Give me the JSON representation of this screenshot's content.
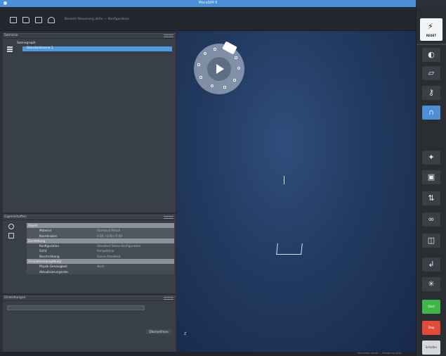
{
  "window": {
    "title": "MecaSIM 6"
  },
  "toolbar": {
    "icons": [
      "new-file-icon",
      "open-folder-icon",
      "save-icon",
      "network-icon"
    ],
    "path_text": "Bereich Steuerung aktiv — Konfiguration"
  },
  "scene": {
    "header": "Szenario",
    "root_label": "Szenegraph",
    "selected_item": "Standardszene 1"
  },
  "properties": {
    "header": "Eigenschaften",
    "rows": [
      {
        "type": "group",
        "key": "Objekt",
        "value": ""
      },
      {
        "type": "sub",
        "key": "Material",
        "value": "Standard Metall"
      },
      {
        "type": "sub",
        "key": "Koordinaten",
        "value": "0.00 / 0.00 / 0.00"
      },
      {
        "type": "group",
        "key": "Darstellung",
        "value": ""
      },
      {
        "type": "plain",
        "key": "Konfiguration",
        "value": "Standard Szene Konfiguration"
      },
      {
        "type": "plain",
        "key": "Sicht",
        "value": "Perspektive"
      },
      {
        "type": "plain",
        "key": "Beschreibung",
        "value": "Szene Standard"
      },
      {
        "type": "group",
        "key": "Simulationsumgebung",
        "value": ""
      },
      {
        "type": "plain",
        "key": "Physik Genauigkeit",
        "value": "Hoch"
      },
      {
        "type": "plain",
        "key": "Aktualisierungsrate",
        "value": ""
      }
    ]
  },
  "settings": {
    "header": "Einstellungen",
    "apply_label": "Übernehmen"
  },
  "viewport": {
    "axis": "Z",
    "status": "Simulation bereit — Rendering aktiv"
  },
  "rightbar": {
    "reset_label": "RESET",
    "buttons": [
      {
        "name": "camera-icon",
        "glyph": "◐",
        "active": false
      },
      {
        "name": "edit-icon",
        "glyph": "▱",
        "active": false
      },
      {
        "name": "key-icon",
        "glyph": "⚷",
        "active": false
      },
      {
        "name": "magnet-icon",
        "glyph": "∩",
        "active": true
      },
      {
        "name": "robot-icon",
        "glyph": "✦",
        "active": false
      },
      {
        "name": "monitor-icon",
        "glyph": "▣",
        "active": false
      },
      {
        "name": "signal-icon",
        "glyph": "⇅",
        "active": false
      },
      {
        "name": "glasses-icon",
        "glyph": "∞",
        "active": false
      },
      {
        "name": "cube-icon",
        "glyph": "◫",
        "active": false
      },
      {
        "name": "arrow-in-icon",
        "glyph": "↲",
        "active": false
      },
      {
        "name": "network-icon",
        "glyph": "✳",
        "active": false
      }
    ],
    "start_label": "Start",
    "stop_label": "Stop",
    "bottom_label": "Schalter"
  },
  "colors": {
    "accent": "#4a8fd8",
    "start": "#3fb54a",
    "stop": "#e24a3b"
  }
}
